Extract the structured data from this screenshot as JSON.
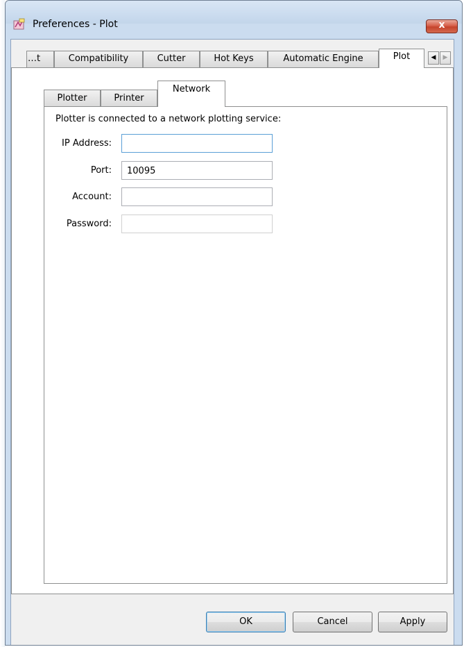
{
  "window": {
    "title": "Preferences - Plot",
    "close_glyph": "x"
  },
  "outer_tabs": [
    {
      "label": "…t"
    },
    {
      "label": "Compatibility"
    },
    {
      "label": "Cutter"
    },
    {
      "label": "Hot Keys"
    },
    {
      "label": "Automatic Engine"
    },
    {
      "label": "Plot"
    }
  ],
  "scroll_arrows": {
    "left": "◀",
    "right": "▶"
  },
  "inner_tabs": [
    {
      "label": "Plotter"
    },
    {
      "label": "Printer"
    },
    {
      "label": "Network"
    }
  ],
  "network": {
    "description": "Plotter is connected to a network plotting service:",
    "ip_label": "IP Address:",
    "ip_value": "",
    "port_label": "Port:",
    "port_value": "10095",
    "account_label": "Account:",
    "account_value": "",
    "password_label": "Password:",
    "password_value": ""
  },
  "buttons": {
    "ok": "OK",
    "cancel": "Cancel",
    "apply": "Apply"
  },
  "colors": {
    "accent": "#5a9fd6",
    "close": "#c5432c"
  }
}
